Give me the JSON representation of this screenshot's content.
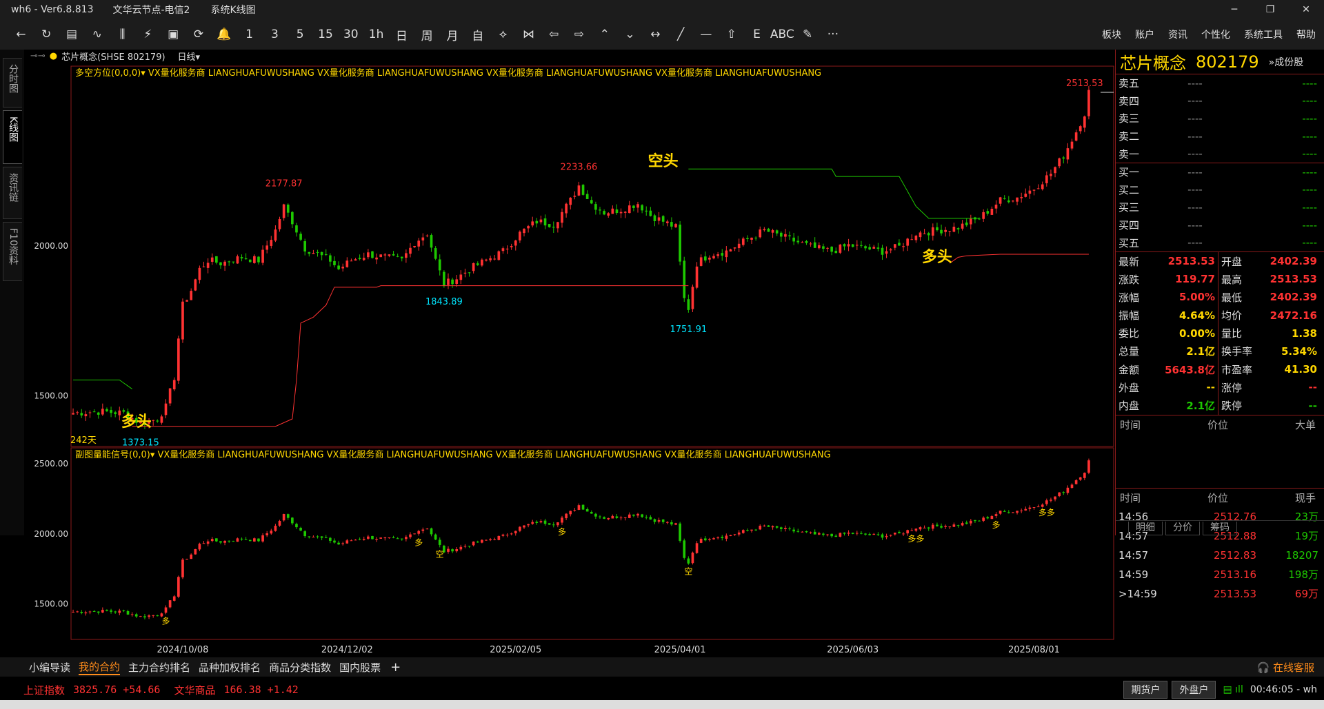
{
  "title": {
    "app": "wh6  -  Ver6.8.813",
    "server": "文华云节点-电信2",
    "view": "系统K线图"
  },
  "window_controls": [
    "─",
    "❐",
    "✕"
  ],
  "toolbar": {
    "icons": [
      "←",
      "↻",
      "▤",
      "∿",
      "⫼",
      "⚡",
      "▣",
      "⟳",
      "🔔",
      "1",
      "3",
      "5",
      "15",
      "30",
      "1h",
      "日",
      "周",
      "月",
      "自",
      "⟡",
      "⋈",
      "⇦",
      "⇨",
      "⌃",
      "⌄",
      "↔",
      "╱",
      "—",
      "⇧",
      "E",
      "ABC",
      "✎",
      "···"
    ],
    "icon_names": [
      "back-icon",
      "refresh-icon",
      "table-icon",
      "line-icon",
      "candle-icon",
      "flash-icon",
      "frame-icon",
      "cycle-icon",
      "bell-icon",
      "period-1-icon",
      "period-3-icon",
      "period-5-icon",
      "period-15-icon",
      "period-30-icon",
      "period-1h-icon",
      "period-day-icon",
      "period-week-icon",
      "period-month-icon",
      "period-custom-icon",
      "zoom-icon",
      "compare-icon",
      "left-icon",
      "right-icon",
      "up-icon",
      "down-icon",
      "range-icon",
      "draw-line-icon",
      "hline-icon",
      "home-icon",
      "e-icon",
      "text-icon",
      "pen-icon",
      "more-icon"
    ],
    "menu": [
      "板块",
      "账户",
      "资讯",
      "个性化",
      "系统工具",
      "帮助"
    ]
  },
  "side_tabs": [
    {
      "label": "分时图",
      "active": false
    },
    {
      "label": "K线图",
      "active": true
    },
    {
      "label": "资讯链",
      "active": false
    },
    {
      "label": "F10资料",
      "active": false
    }
  ],
  "chart_header": {
    "dash": "⊸⊸",
    "dot": "●",
    "name": "芯片概念(SHSE 802179)",
    "period": "日线▾"
  },
  "indicator_main": "多空方位(0,0,0)▾  VX量化服务商  LIANGHUAFUWUSHANG  VX量化服务商  LIANGHUAFUWUSHANG  VX量化服务商  LIANGHUAFUWUSHANG  VX量化服务商  LIANGHUAFUWUSHANG",
  "indicator_sub": "副图量能信号(0,0)▾  VX量化服务商  LIANGHUAFUWUSHANG  VX量化服务商  LIANGHUAFUWUSHANG  VX量化服务商  LIANGHUAFUWUSHANG  VX量化服务商  LIANGHUAFUWUSHANG",
  "colors": {
    "up": "#ff3232",
    "down": "#1ec800",
    "yellow": "#ffd700",
    "cyan": "#00e5ff",
    "frame": "#8b1a1a"
  },
  "chart_data": {
    "type": "candlestick",
    "main_yticks": [
      2000.0,
      1500.0
    ],
    "main_ytick_labels": [
      "2000.00",
      "1500.00"
    ],
    "sub_yticks": [
      2500.0,
      2000.0,
      1500.0
    ],
    "sub_ytick_labels": [
      "2500.00",
      "2000.00",
      "1500.00"
    ],
    "x_labels": [
      "2024/10/08",
      "2024/12/02",
      "2025/02/05",
      "2025/04/01",
      "2025/06/03",
      "2025/08/01"
    ],
    "x_label_index": [
      26,
      65,
      105,
      144,
      185,
      228
    ],
    "bar_count": 242,
    "bar_count_label": "242天",
    "markers": [
      {
        "label": "2177.87",
        "idx": 50,
        "price": 2177.87,
        "kind": "high"
      },
      {
        "label": "2233.66",
        "idx": 120,
        "price": 2233.66,
        "kind": "high"
      },
      {
        "label": "2513.53",
        "idx": 240,
        "price": 2513.53,
        "kind": "high"
      },
      {
        "label": "1373.15",
        "idx": 16,
        "price": 1373.15,
        "kind": "low"
      },
      {
        "label": "1843.89",
        "idx": 88,
        "price": 1843.89,
        "kind": "low"
      },
      {
        "label": "1751.91",
        "idx": 146,
        "price": 1751.91,
        "kind": "low"
      }
    ],
    "annotations": [
      {
        "text": "空头",
        "idx": 140,
        "price": 2265
      },
      {
        "text": "多头",
        "idx": 205,
        "price": 1945
      },
      {
        "text": "多头",
        "idx": 15,
        "price": 1395
      }
    ],
    "sub_labels": [
      {
        "text": "多",
        "idx": 22
      },
      {
        "text": "多",
        "idx": 82
      },
      {
        "text": "空",
        "idx": 87
      },
      {
        "text": "多",
        "idx": 116
      },
      {
        "text": "空",
        "idx": 146
      },
      {
        "text": "多多",
        "idx": 200
      },
      {
        "text": "多",
        "idx": 219
      },
      {
        "text": "多多",
        "idx": 231
      }
    ],
    "anchors": [
      [
        0,
        1440
      ],
      [
        6,
        1445
      ],
      [
        12,
        1440
      ],
      [
        16,
        1405
      ],
      [
        20,
        1420
      ],
      [
        22,
        1460
      ],
      [
        24,
        1560
      ],
      [
        25,
        1690
      ],
      [
        26,
        1800
      ],
      [
        28,
        1850
      ],
      [
        30,
        1920
      ],
      [
        32,
        1950
      ],
      [
        35,
        1940
      ],
      [
        40,
        1960
      ],
      [
        44,
        1950
      ],
      [
        48,
        2050
      ],
      [
        50,
        2130
      ],
      [
        52,
        2080
      ],
      [
        55,
        1990
      ],
      [
        58,
        1970
      ],
      [
        61,
        1950
      ],
      [
        63,
        1920
      ],
      [
        66,
        1950
      ],
      [
        70,
        1970
      ],
      [
        74,
        1960
      ],
      [
        78,
        1950
      ],
      [
        81,
        2010
      ],
      [
        84,
        2040
      ],
      [
        86,
        1950
      ],
      [
        88,
        1870
      ],
      [
        91,
        1890
      ],
      [
        94,
        1920
      ],
      [
        98,
        1950
      ],
      [
        102,
        1980
      ],
      [
        106,
        2040
      ],
      [
        110,
        2080
      ],
      [
        114,
        2070
      ],
      [
        118,
        2150
      ],
      [
        120,
        2200
      ],
      [
        123,
        2140
      ],
      [
        126,
        2110
      ],
      [
        130,
        2120
      ],
      [
        134,
        2140
      ],
      [
        137,
        2100
      ],
      [
        140,
        2080
      ],
      [
        143,
        2060
      ],
      [
        145,
        1820
      ],
      [
        146,
        1790
      ],
      [
        148,
        1940
      ],
      [
        151,
        1970
      ],
      [
        155,
        1980
      ],
      [
        160,
        2020
      ],
      [
        164,
        2050
      ],
      [
        168,
        2030
      ],
      [
        172,
        2010
      ],
      [
        176,
        1990
      ],
      [
        180,
        1980
      ],
      [
        184,
        2000
      ],
      [
        188,
        1990
      ],
      [
        192,
        1980
      ],
      [
        196,
        1995
      ],
      [
        200,
        2040
      ],
      [
        205,
        2050
      ],
      [
        210,
        2060
      ],
      [
        215,
        2090
      ],
      [
        220,
        2150
      ],
      [
        224,
        2160
      ],
      [
        228,
        2190
      ],
      [
        232,
        2240
      ],
      [
        235,
        2300
      ],
      [
        238,
        2380
      ],
      [
        240,
        2440
      ],
      [
        241,
        2513
      ]
    ],
    "stop_lines": [
      {
        "color": "#1ec800",
        "points": [
          [
            0,
            1550
          ],
          [
            11,
            1550
          ],
          [
            12,
            1540
          ],
          [
            13,
            1530
          ],
          [
            14,
            1520
          ]
        ]
      },
      {
        "color": "#ff3232",
        "points": [
          [
            14,
            1395
          ],
          [
            48,
            1395
          ],
          [
            52,
            1420
          ],
          [
            53,
            1550
          ],
          [
            54,
            1740
          ],
          [
            57,
            1760
          ],
          [
            60,
            1800
          ],
          [
            62,
            1860
          ],
          [
            72,
            1860
          ],
          [
            73,
            1865
          ],
          [
            120,
            1865
          ],
          [
            146,
            1865
          ]
        ]
      },
      {
        "color": "#1ec800",
        "points": [
          [
            146,
            2255
          ],
          [
            180,
            2255
          ],
          [
            181,
            2230
          ],
          [
            196,
            2230
          ],
          [
            198,
            2180
          ],
          [
            200,
            2130
          ],
          [
            203,
            2090
          ],
          [
            215,
            2090
          ]
        ]
      },
      {
        "color": "#ff3232",
        "points": [
          [
            208,
            1940
          ],
          [
            210,
            1960
          ],
          [
            212,
            1965
          ],
          [
            220,
            1970
          ],
          [
            241,
            1970
          ]
        ]
      }
    ]
  },
  "quote": {
    "name": "芯片概念",
    "code": "802179",
    "components": "»成份股",
    "asks": [
      {
        "label": "卖五",
        "price": "----",
        "vol": "----"
      },
      {
        "label": "卖四",
        "price": "----",
        "vol": "----"
      },
      {
        "label": "卖三",
        "price": "----",
        "vol": "----"
      },
      {
        "label": "卖二",
        "price": "----",
        "vol": "----"
      },
      {
        "label": "卖一",
        "price": "----",
        "vol": "----"
      }
    ],
    "bids": [
      {
        "label": "买一",
        "price": "----",
        "vol": "----"
      },
      {
        "label": "买二",
        "price": "----",
        "vol": "----"
      },
      {
        "label": "买三",
        "price": "----",
        "vol": "----"
      },
      {
        "label": "买四",
        "price": "----",
        "vol": "----"
      },
      {
        "label": "买五",
        "price": "----",
        "vol": "----"
      }
    ],
    "stats": [
      {
        "k": "最新",
        "v": "2513.53",
        "c": "red"
      },
      {
        "k": "开盘",
        "v": "2402.39",
        "c": "red"
      },
      {
        "k": "涨跌",
        "v": "119.77",
        "c": "red"
      },
      {
        "k": "最高",
        "v": "2513.53",
        "c": "red"
      },
      {
        "k": "涨幅",
        "v": "5.00%",
        "c": "red"
      },
      {
        "k": "最低",
        "v": "2402.39",
        "c": "red"
      },
      {
        "k": "振幅",
        "v": "4.64%",
        "c": "yellow"
      },
      {
        "k": "均价",
        "v": "2472.16",
        "c": "red"
      },
      {
        "k": "委比",
        "v": "0.00%",
        "c": "yellow"
      },
      {
        "k": "量比",
        "v": "1.38",
        "c": "yellow"
      },
      {
        "k": "总量",
        "v": "2.1亿",
        "c": "yellow"
      },
      {
        "k": "换手率",
        "v": "5.34%",
        "c": "yellow"
      },
      {
        "k": "金额",
        "v": "5643.8亿",
        "c": "red"
      },
      {
        "k": "市盈率",
        "v": "41.30",
        "c": "yellow"
      },
      {
        "k": "外盘",
        "v": "--",
        "c": "yellow"
      },
      {
        "k": "涨停",
        "v": "--",
        "c": "red"
      },
      {
        "k": "内盘",
        "v": "2.1亿",
        "c": "green"
      },
      {
        "k": "跌停",
        "v": "--",
        "c": "green"
      }
    ],
    "big_head": [
      "时间",
      "价位",
      "大单"
    ],
    "ticks_head": [
      "时间",
      "价位",
      "现手"
    ],
    "ticks": [
      {
        "t": "14:56",
        "p": "2512.76",
        "v": "23万",
        "c": "green"
      },
      {
        "t": "14:57",
        "p": "2512.88",
        "v": "19万",
        "c": "green"
      },
      {
        "t": "14:57",
        "p": "2512.83",
        "v": "18207",
        "c": "green"
      },
      {
        "t": "14:59",
        "p": "2513.16",
        "v": "198万",
        "c": "green"
      },
      {
        "t": ">14:59",
        "p": "2513.53",
        "v": "69万",
        "c": "red"
      }
    ],
    "tabs": [
      "明细",
      "分价",
      "筹码"
    ]
  },
  "bottom_tabs": [
    "小编导读",
    "我的合约",
    "主力合约排名",
    "品种加权排名",
    "商品分类指数",
    "国内股票"
  ],
  "bottom_active": 1,
  "plus": "+",
  "customer_service": "🎧 在线客服",
  "status": {
    "idx1": "上证指数",
    "idx1v": "3825.76  +54.66",
    "idx2": "文华商品",
    "idx2v": "166.38  +1.42",
    "btn1": "期货户",
    "btn2": "外盘户",
    "signal": "▤ ıll",
    "time": "00:46:05 - wh"
  }
}
